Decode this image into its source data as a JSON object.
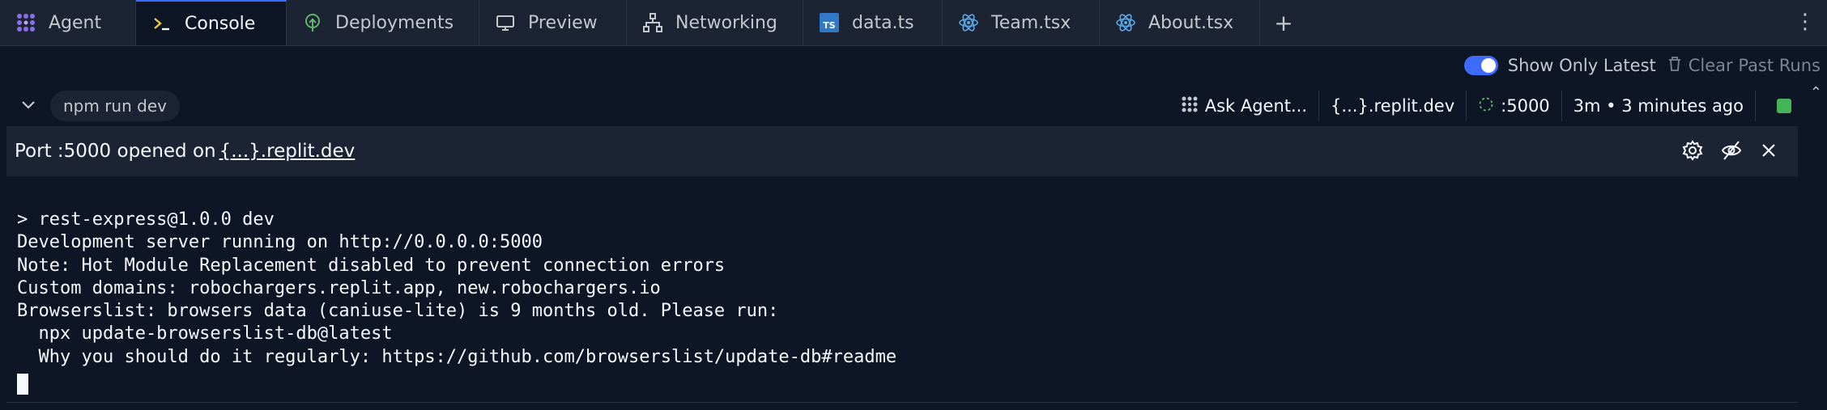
{
  "tabs": [
    {
      "label": "Agent",
      "icon": "agent-icon",
      "active": false
    },
    {
      "label": "Console",
      "icon": "terminal-icon",
      "active": true
    },
    {
      "label": "Deployments",
      "icon": "deployments-icon",
      "active": false
    },
    {
      "label": "Preview",
      "icon": "monitor-icon",
      "active": false
    },
    {
      "label": "Networking",
      "icon": "network-icon",
      "active": false
    },
    {
      "label": "data.ts",
      "icon": "typescript-file-icon",
      "active": false
    },
    {
      "label": "Team.tsx",
      "icon": "react-file-icon",
      "active": false
    },
    {
      "label": "About.tsx",
      "icon": "react-file-icon",
      "active": false
    }
  ],
  "controls": {
    "show_only_latest": "Show Only Latest",
    "show_only_latest_on": true,
    "clear_past_runs": "Clear Past Runs"
  },
  "process": {
    "command": "npm run dev",
    "ask_agent": "Ask Agent...",
    "domain": "{...}.replit.dev",
    "port": ":5000",
    "uptime": "3m • 3 minutes ago",
    "status_color": "#44b556"
  },
  "banner": {
    "prefix": "Port :5000 opened on",
    "link": "{...}.replit.dev"
  },
  "console": {
    "lines": [
      "> rest-express@1.0.0 dev",
      "Development server running on http://0.0.0.0:5000",
      "Note: Hot Module Replacement disabled to prevent connection errors",
      "Custom domains: robochargers.replit.app, new.robochargers.io",
      "Browserslist: browsers data (caniuse-lite) is 9 months old. Please run:",
      "  npx update-browserslist-db@latest",
      "  Why you should do it regularly: https://github.com/browserslist/update-db#readme"
    ]
  },
  "colors": {
    "accent": "#3d6bff",
    "background": "#0e1525",
    "surface": "#1c2333"
  }
}
